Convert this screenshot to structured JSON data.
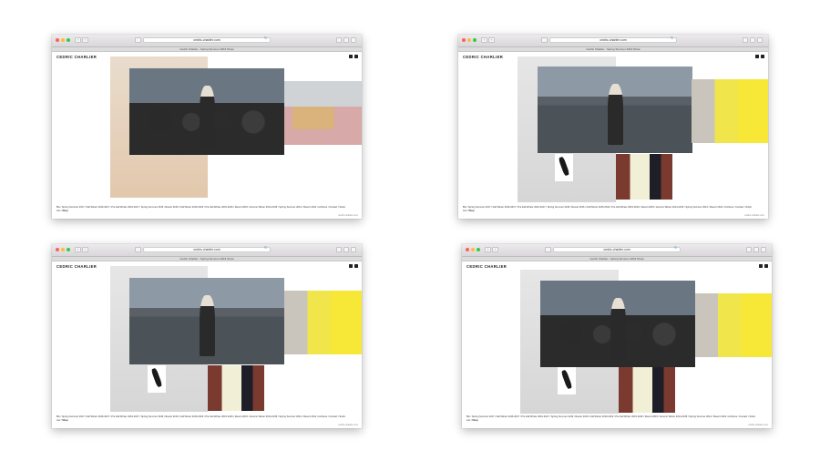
{
  "browser": {
    "url": "cedric-charlier.com",
    "tab_title": "Cedric Charlier - Spring Summer 2016 Show",
    "reload_glyph": "↻",
    "back_glyph": "‹",
    "forward_glyph": "›"
  },
  "site": {
    "logo": "CEDRIC CHARLIER",
    "social": [
      "instagram-icon",
      "facebook-icon"
    ],
    "footer_text": "Bio / Spring Summer 2017 / Fall Winter 2016-2017 / Pre Fall Winter 2016-2017 / Spring Summer 2016 / Resort 2016 / Fall Winter 2015-2016 / Pre Fall Winter 2015-2016 / Resort 2015 / Autumn Winter 2014-2015 / Spring Summer 2014 / Resort 2014 / Archives / Contact / Stock List / ",
    "footer_last": "Shop",
    "credit": "cedric-charlier.com"
  },
  "colors": {
    "traffic_red": "#fc605c",
    "traffic_yellow": "#fdbc40",
    "traffic_green": "#34c84a",
    "reload_blue": "#4a90e2"
  }
}
